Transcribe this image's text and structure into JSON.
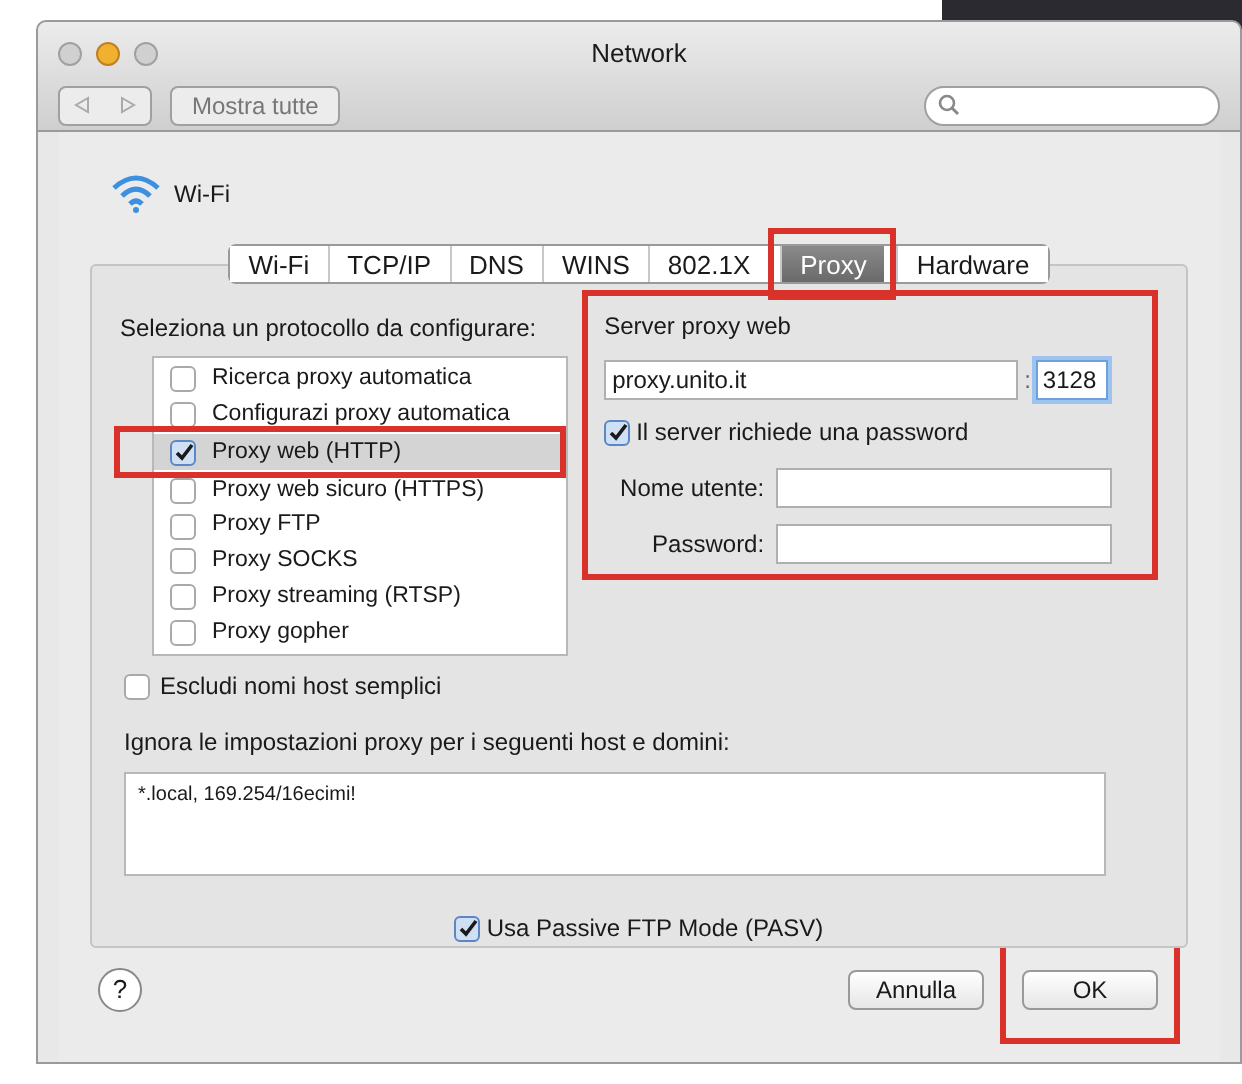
{
  "window": {
    "title": "Network"
  },
  "toolbar": {
    "show_all": "Mostra tutte"
  },
  "interface": {
    "name": "Wi-Fi"
  },
  "tabs": [
    {
      "label": "Wi-Fi",
      "selected": false,
      "highlighted": false
    },
    {
      "label": "TCP/IP",
      "selected": false,
      "highlighted": false
    },
    {
      "label": "DNS",
      "selected": false,
      "highlighted": false
    },
    {
      "label": "WINS",
      "selected": false,
      "highlighted": false
    },
    {
      "label": "802.1X",
      "selected": false,
      "highlighted": false
    },
    {
      "label": "Proxy",
      "selected": true,
      "highlighted": true
    },
    {
      "label": "Hardware",
      "selected": false,
      "highlighted": false
    }
  ],
  "protocols": {
    "heading": "Seleziona un protocollo da configurare:",
    "items": [
      {
        "label": "Ricerca proxy automatica",
        "checked": false,
        "selected": false,
        "highlighted": false
      },
      {
        "label": "Configurazi proxy automatica",
        "checked": false,
        "selected": false,
        "highlighted": false
      },
      {
        "label": "Proxy web (HTTP)",
        "checked": true,
        "selected": true,
        "highlighted": true
      },
      {
        "label": "Proxy web sicuro (HTTPS)",
        "checked": false,
        "selected": false,
        "highlighted": false
      },
      {
        "label": "Proxy FTP",
        "checked": false,
        "selected": false,
        "highlighted": false
      },
      {
        "label": "Proxy SOCKS",
        "checked": false,
        "selected": false,
        "highlighted": false
      },
      {
        "label": "Proxy streaming (RTSP)",
        "checked": false,
        "selected": false,
        "highlighted": false
      },
      {
        "label": "Proxy gopher",
        "checked": false,
        "selected": false,
        "highlighted": false
      }
    ]
  },
  "server": {
    "title": "Server proxy web",
    "host": "proxy.unito.it",
    "separator": ":",
    "port": "3128",
    "highlighted": true,
    "requires_password": {
      "label": "Il server richiede una password",
      "checked": true
    },
    "username_label": "Nome utente:",
    "password_label": "Password:"
  },
  "exclude_simple": {
    "label": "Escludi nomi host semplici",
    "checked": false
  },
  "bypass": {
    "label": "Ignora le impostazioni proxy per i seguenti host e domini:",
    "value": "*.local, 169.254/16ecimi!"
  },
  "passive_ftp": {
    "label": "Usa Passive FTP Mode (PASV)",
    "checked": true
  },
  "help": "?",
  "buttons": [
    {
      "label": "Annulla",
      "highlighted": false
    },
    {
      "label": "OK",
      "highlighted": true
    }
  ]
}
